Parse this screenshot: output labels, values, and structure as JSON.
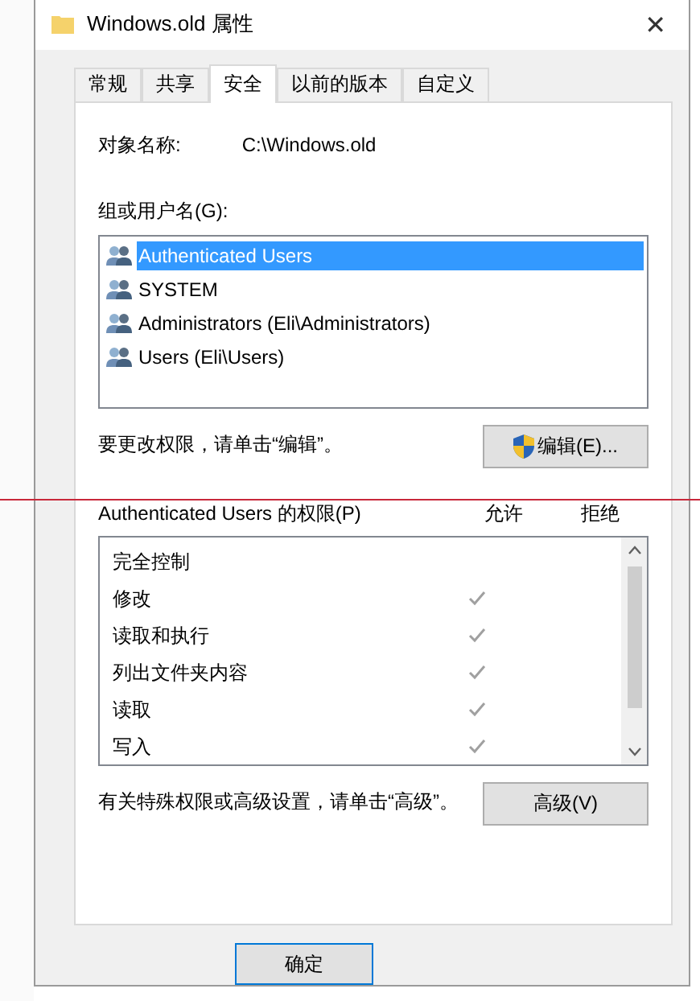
{
  "window": {
    "title": "Windows.old 属性",
    "close": "✕"
  },
  "tabs": [
    {
      "label": "常规",
      "selected": false
    },
    {
      "label": "共享",
      "selected": false
    },
    {
      "label": "安全",
      "selected": true
    },
    {
      "label": "以前的版本",
      "selected": false
    },
    {
      "label": "自定义",
      "selected": false
    }
  ],
  "object": {
    "label": "对象名称:",
    "value": "C:\\Windows.old"
  },
  "groups": {
    "label": "组或用户名(G):",
    "items": [
      {
        "name": "Authenticated Users",
        "selected": true
      },
      {
        "name": "SYSTEM",
        "selected": false
      },
      {
        "name": "Administrators (Eli\\Administrators)",
        "selected": false
      },
      {
        "name": "Users (Eli\\Users)",
        "selected": false
      }
    ]
  },
  "edit_hint": "要更改权限，请单击“编辑”。",
  "edit_button": "编辑(E)...",
  "permissions": {
    "label": "Authenticated Users 的权限(P)",
    "allow_header": "允许",
    "deny_header": "拒绝",
    "items": [
      {
        "name": "完全控制",
        "allow": false,
        "deny": false
      },
      {
        "name": "修改",
        "allow": true,
        "deny": false
      },
      {
        "name": "读取和执行",
        "allow": true,
        "deny": false
      },
      {
        "name": "列出文件夹内容",
        "allow": true,
        "deny": false
      },
      {
        "name": "读取",
        "allow": true,
        "deny": false
      },
      {
        "name": "写入",
        "allow": true,
        "deny": false
      }
    ]
  },
  "advanced_hint": "有关特殊权限或高级设置，请单击“高级”。",
  "advanced_button": "高级(V)",
  "ok_button": "确定"
}
